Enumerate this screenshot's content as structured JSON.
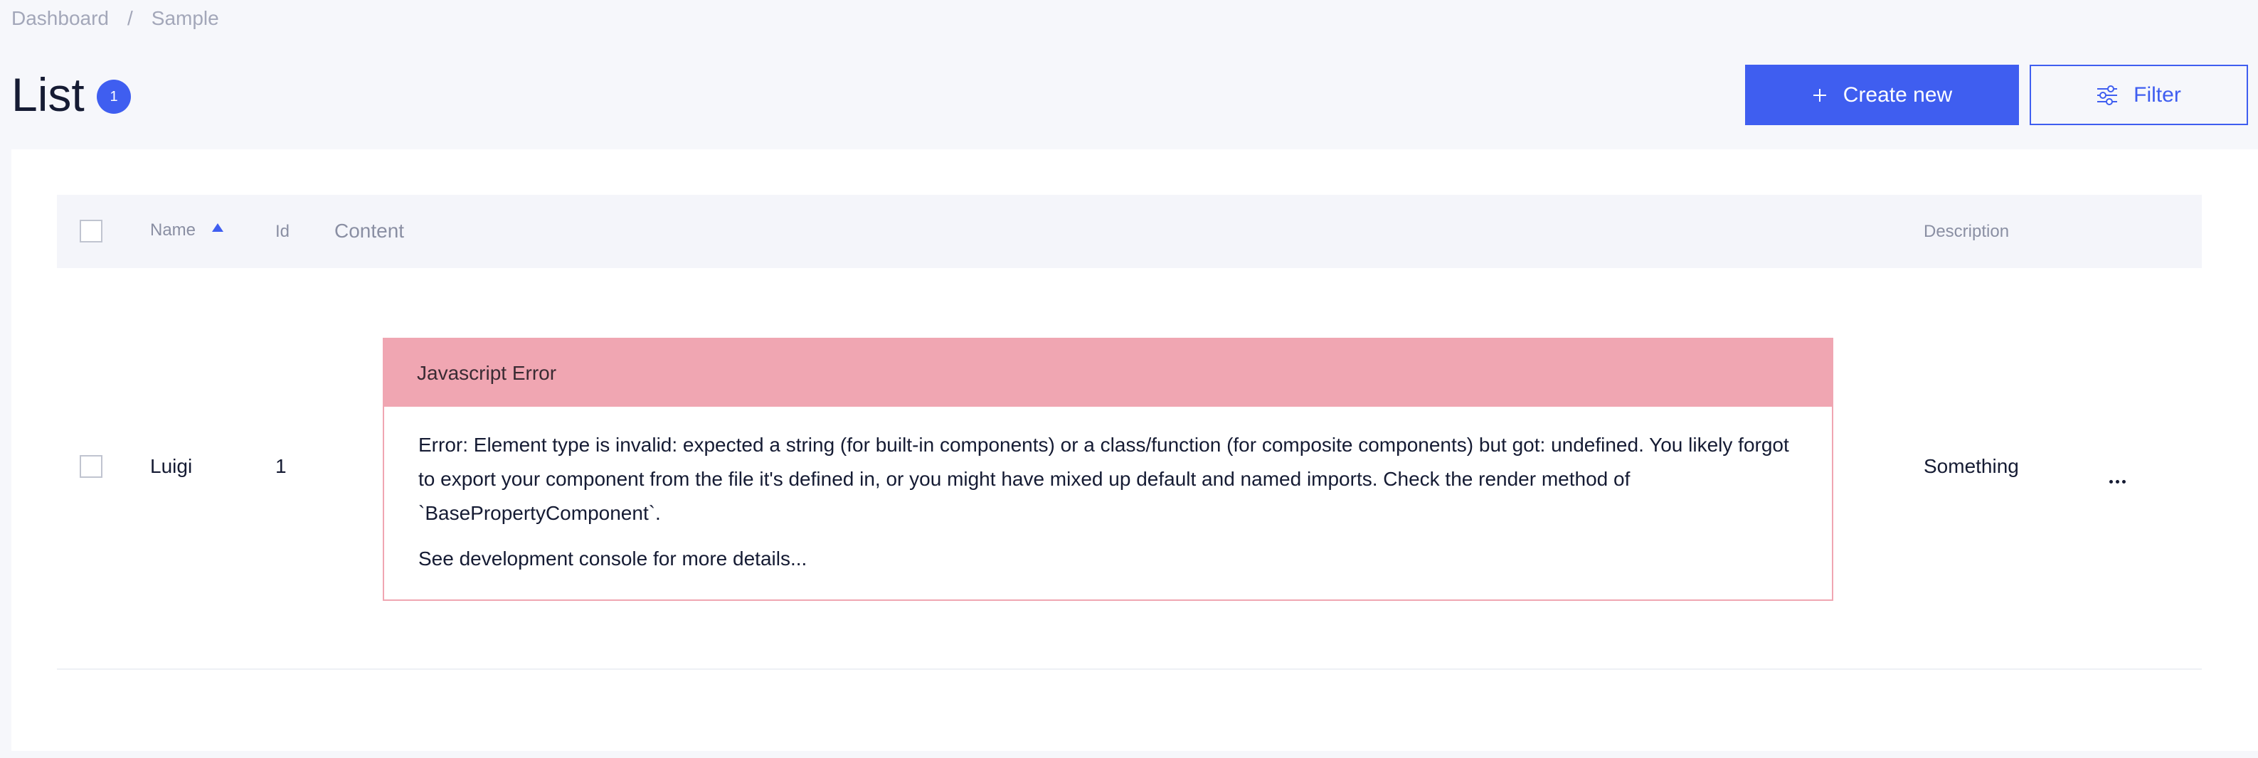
{
  "breadcrumb": {
    "items": [
      "Dashboard",
      "Sample"
    ],
    "separator": "/"
  },
  "page": {
    "title": "List",
    "count": "1"
  },
  "toolbar": {
    "create_label": "Create new",
    "filter_label": "Filter"
  },
  "table": {
    "columns": {
      "name": "Name",
      "id": "Id",
      "content": "Content",
      "description": "Description"
    },
    "sort": {
      "column": "name",
      "direction": "asc"
    },
    "rows": [
      {
        "name": "Luigi",
        "id": "1",
        "description": "Something",
        "content_error": {
          "title": "Javascript Error",
          "message": "Error: Element type is invalid: expected a string (for built-in components) or a class/function (for composite components) but got: undefined. You likely forgot to export your component from the file it's defined in, or you might have mixed up default and named imports. Check the render method of `BasePropertyComponent`.",
          "hint": "See development console for more details..."
        }
      }
    ]
  },
  "icons": {
    "create": "plus-icon",
    "filter": "sliders-icon",
    "row_actions": "more-horizontal-icon",
    "sort": "sort-ascending-icon"
  },
  "colors": {
    "accent": "#3f5ef0",
    "error_header": "#f0a6b2",
    "error_border": "#f0a6b2",
    "page_background": "#f6f7fb",
    "table_header_background": "#f4f5fa"
  }
}
